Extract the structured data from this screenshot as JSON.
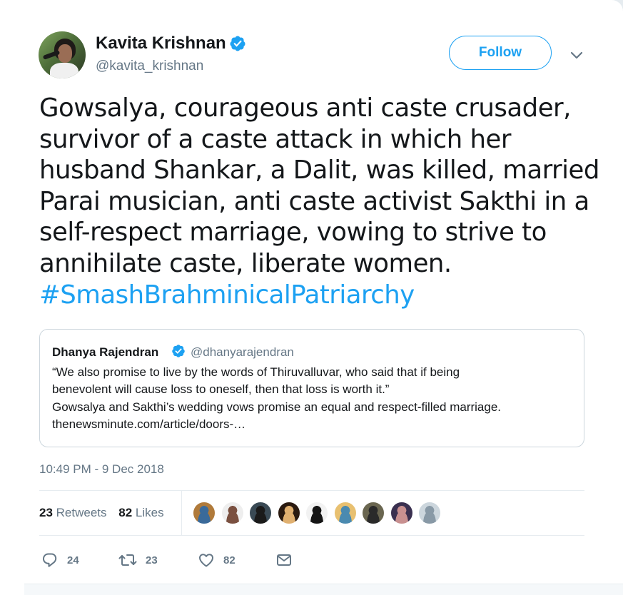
{
  "author": {
    "name": "Kavita Krishnan",
    "handle": "@kavita_krishnan",
    "avatar": "author-avatar-photo"
  },
  "follow_button": {
    "label": "Follow"
  },
  "tweet": {
    "text_lines": [
      "Gowsalya, courageous anti caste crusader,",
      "survivor of a caste attack in which her",
      "husband Shankar, a Dalit, was killed, married",
      "Parai musician, anti caste activist Sakthi in a",
      "self-respect marriage, vowing to strive to",
      "annihilate caste, liberate women."
    ],
    "hashtag": "#SmashBrahminicalPatriarchy"
  },
  "quoted_tweet": {
    "name": "Dhanya Rajendran",
    "handle": "@dhanyarajendran",
    "text_lines": [
      "“We also promise to live by the words of Thiruvalluvar, who said that if being",
      "benevolent will cause loss to oneself, then that loss is worth it.”",
      "Gowsalya and Sakthi’s wedding vows promise an equal and respect-filled marriage.",
      "thenewsminute.com/article/doors-…"
    ]
  },
  "timestamp": "10:49 PM - 9 Dec 2018",
  "stats": {
    "retweets_count": "23",
    "retweets_label": "Retweets",
    "likes_count": "82",
    "likes_label": "Likes"
  },
  "liker_avatars": [
    {
      "bg": "#b07a3a",
      "accent": "#3a6a9a"
    },
    {
      "bg": "#eeeeee",
      "accent": "#7a5040"
    },
    {
      "bg": "#3a4a55",
      "accent": "#1a1a1a"
    },
    {
      "bg": "#2a1a10",
      "accent": "#e0b070"
    },
    {
      "bg": "#f2f2f2",
      "accent": "#151515"
    },
    {
      "bg": "#e8c070",
      "accent": "#4a8ab0"
    },
    {
      "bg": "#6a6650",
      "accent": "#2a2a2a"
    },
    {
      "bg": "#3a3050",
      "accent": "#c89090"
    },
    {
      "bg": "#ccd6dd",
      "accent": "#8899a6"
    }
  ],
  "actions": {
    "reply_count": "24",
    "retweet_count": "23",
    "like_count": "82"
  },
  "colors": {
    "accent": "#1da1f2",
    "muted": "#657786",
    "text": "#14171a",
    "border": "#e6ecf0"
  }
}
